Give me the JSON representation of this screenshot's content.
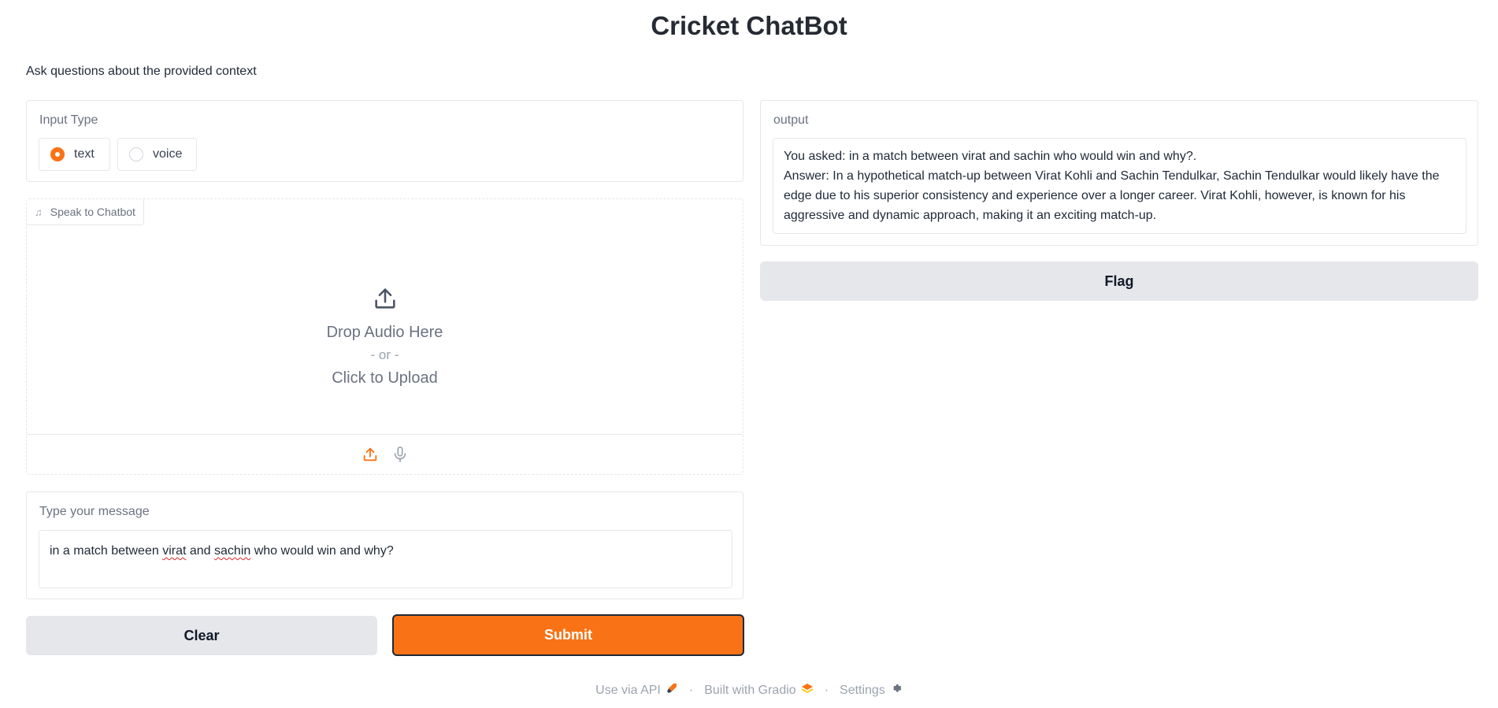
{
  "app": {
    "title": "Cricket ChatBot",
    "description": "Ask questions about the provided context"
  },
  "input_type": {
    "label": "Input Type",
    "options": [
      "text",
      "voice"
    ],
    "selected": "text"
  },
  "audio": {
    "label": "Speak to Chatbot",
    "drop_text": "Drop Audio Here",
    "or_text": "- or -",
    "upload_text": "Click to Upload",
    "sources": [
      "upload-icon",
      "microphone-icon"
    ],
    "active_source": "upload"
  },
  "message": {
    "label": "Type your message",
    "value_parts": [
      "in a match between ",
      "virat",
      " and ",
      "sachin",
      " who would win and why?"
    ]
  },
  "buttons": {
    "clear": "Clear",
    "submit": "Submit",
    "flag": "Flag"
  },
  "output": {
    "label": "output",
    "line1": "You asked: in a match between virat and sachin who would win and why?.",
    "line2": "Answer: In a hypothetical match-up between Virat Kohli and Sachin Tendulkar, Sachin Tendulkar would likely have the edge due to his superior consistency and experience over a longer career. Virat Kohli, however, is known for his aggressive and dynamic approach, making it an exciting match-up."
  },
  "footer": {
    "api": "Use via API",
    "built": "Built with Gradio",
    "settings": "Settings",
    "separator": "·"
  },
  "colors": {
    "accent": "#f97316",
    "button_gray": "#e5e7eb",
    "border": "#e5e7eb"
  }
}
